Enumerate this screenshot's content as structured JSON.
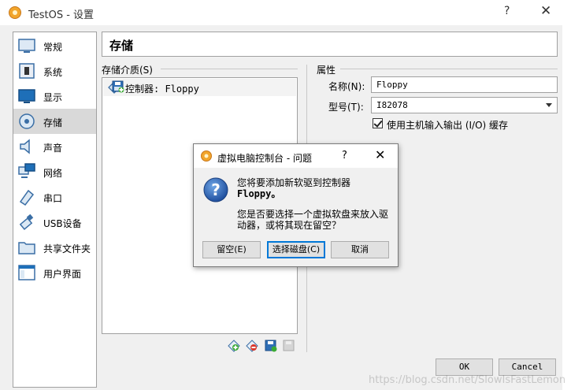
{
  "window": {
    "title": "TestOS - 设置",
    "help": "?",
    "close": "✕"
  },
  "sidebar": {
    "items": [
      {
        "label": "常规",
        "icon": "monitor-icon"
      },
      {
        "label": "系统",
        "icon": "chip-icon"
      },
      {
        "label": "显示",
        "icon": "display-icon"
      },
      {
        "label": "存储",
        "icon": "disk-icon",
        "selected": true
      },
      {
        "label": "声音",
        "icon": "speaker-icon"
      },
      {
        "label": "网络",
        "icon": "network-icon"
      },
      {
        "label": "串口",
        "icon": "serial-port-icon"
      },
      {
        "label": "USB设备",
        "icon": "usb-icon"
      },
      {
        "label": "共享文件夹",
        "icon": "folder-icon"
      },
      {
        "label": "用户界面",
        "icon": "ui-window-icon"
      }
    ]
  },
  "page": {
    "title": "存储"
  },
  "storage": {
    "media_label": "存储介质(S)",
    "controller_label": "控制器: Floppy"
  },
  "properties": {
    "section_label": "属性",
    "name_label": "名称(N):",
    "name_value": "Floppy",
    "type_label": "型号(T):",
    "type_value": "I82078",
    "host_io_label": "使用主机输入输出 (I/O) 缓存",
    "host_io_checked": true
  },
  "dialog": {
    "title": "虚拟电脑控制台 - 问题",
    "help": "?",
    "close": "✕",
    "message_line1": "您将要添加新软驱到控制器",
    "message_line2": "Floppy。",
    "message_question": "您是否要选择一个虚拟软盘来放入驱动器，或将其现在留空？",
    "btn_leave_empty": "留空(E)",
    "btn_choose_disk": "选择磁盘(C)",
    "btn_cancel": "取消"
  },
  "buttons": {
    "ok": "OK",
    "cancel": "Cancel"
  },
  "watermark": "https://blog.csdn.net/SlowIsFastLemon",
  "colors": {
    "accent": "#0078d7",
    "highlight_border": "#e05555",
    "selected_bg": "#d9d9d9"
  }
}
